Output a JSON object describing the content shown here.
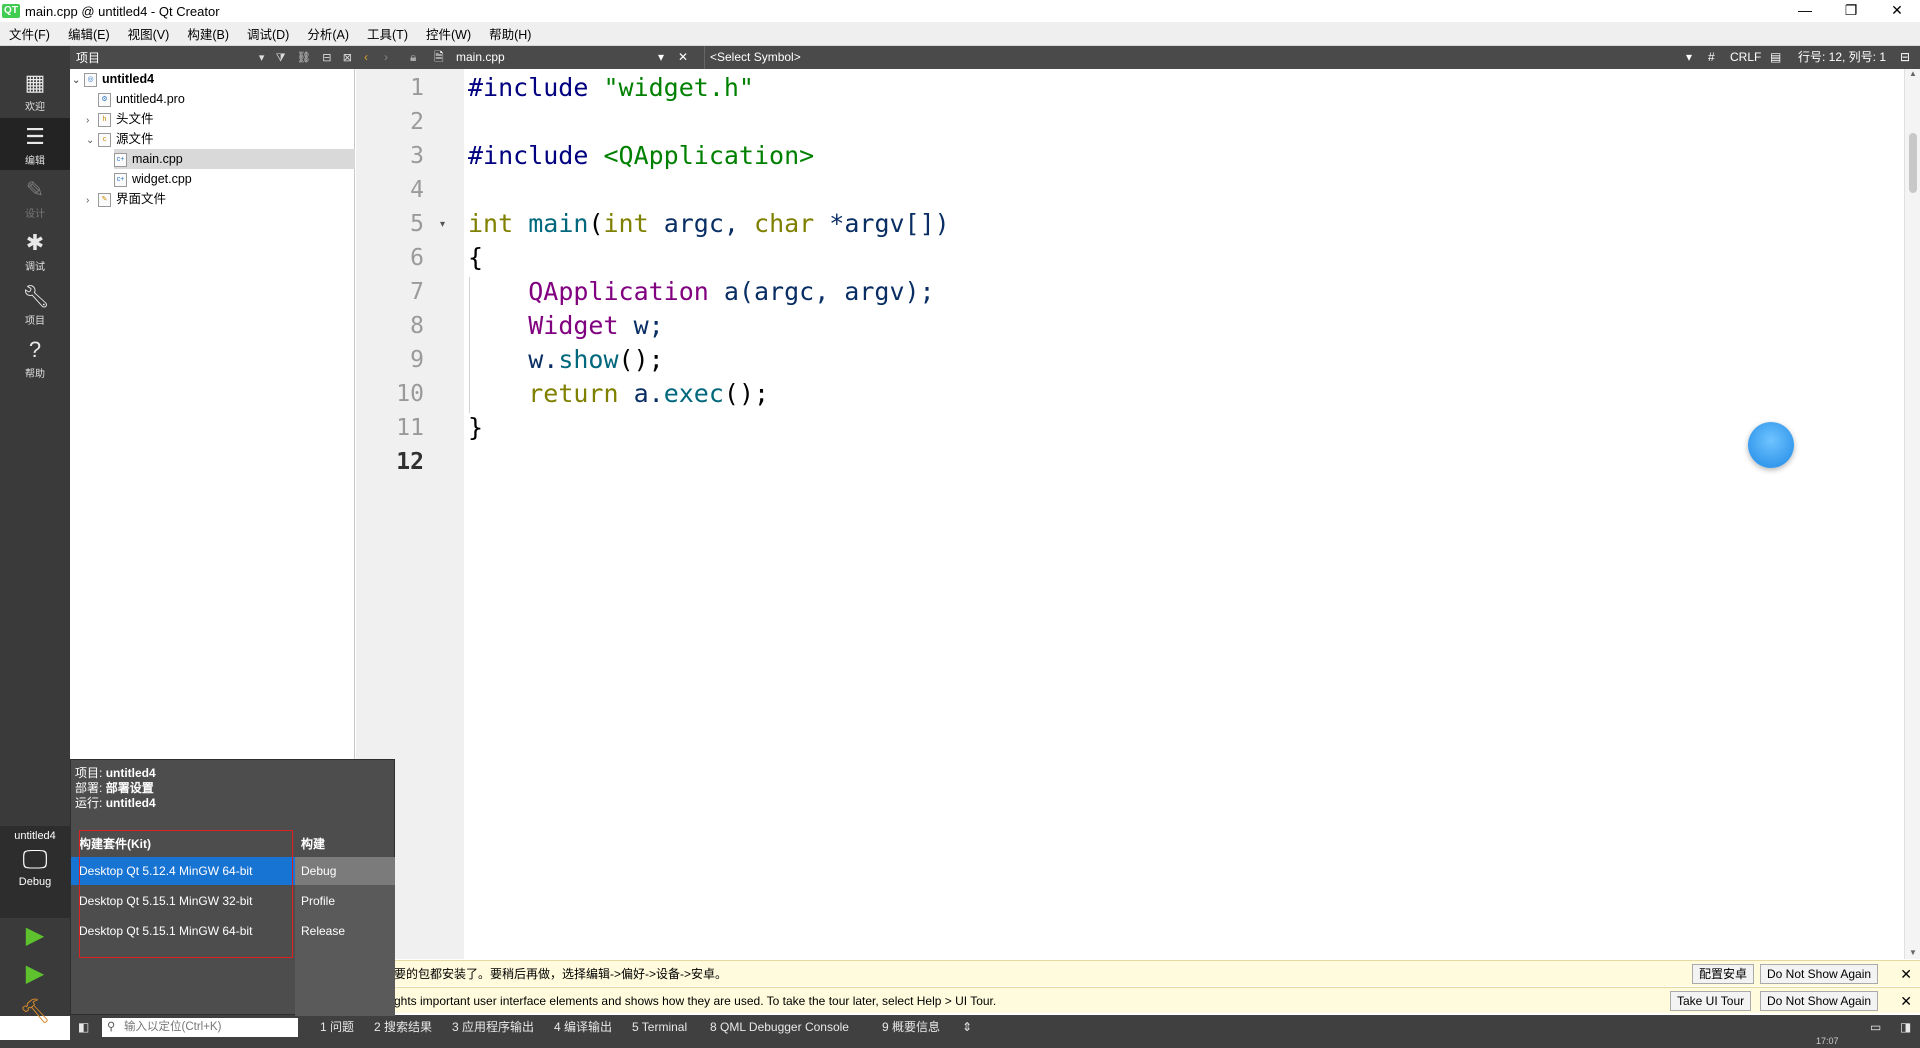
{
  "window": {
    "logo": "QT",
    "title": "main.cpp @ untitled4 - Qt Creator",
    "controls": [
      "—",
      "❐",
      "✕"
    ]
  },
  "menu": [
    "文件(F)",
    "编辑(E)",
    "视图(V)",
    "构建(B)",
    "调试(D)",
    "分析(A)",
    "工具(T)",
    "控件(W)",
    "帮助(H)"
  ],
  "modes": [
    {
      "label": "欢迎",
      "icon": "grid-icon"
    },
    {
      "label": "编辑",
      "icon": "edit-icon"
    },
    {
      "label": "设计",
      "icon": "pencil-icon"
    },
    {
      "label": "调试",
      "icon": "bug-icon"
    },
    {
      "label": "项目",
      "icon": "wrench-icon"
    },
    {
      "label": "帮助",
      "icon": "help-icon"
    }
  ],
  "project_panel": {
    "title": "项目",
    "tree": [
      {
        "label": "untitled4",
        "level": 0,
        "expanded": true,
        "bold": true
      },
      {
        "label": "untitled4.pro",
        "level": 1
      },
      {
        "label": "头文件",
        "level": 1,
        "expanded": false
      },
      {
        "label": "源文件",
        "level": 1,
        "expanded": true
      },
      {
        "label": "main.cpp",
        "level": 2,
        "selected": true
      },
      {
        "label": "widget.cpp",
        "level": 2
      },
      {
        "label": "界面文件",
        "level": 1,
        "expanded": false
      }
    ]
  },
  "editor_toolbar": {
    "file": "main.cpp",
    "symbol": "<Select Symbol>",
    "hash": "#",
    "line_ending": "CRLF",
    "position": "行号: 12, 列号: 1"
  },
  "code_lines": [
    "1",
    "2",
    "3",
    "4",
    "5",
    "6",
    "7",
    "8",
    "9",
    "10",
    "11",
    "12"
  ],
  "code": {
    "l1a": "#include ",
    "l1b": "\"widget.h\"",
    "l3a": "#include ",
    "l3b": "<QApplication>",
    "l5a": "int",
    "l5b": " ",
    "l5c": "main",
    "l5d": "(",
    "l5e": "int",
    "l5f": " argc, ",
    "l5g": "char",
    "l5h": " *argv[])",
    "l6": "{",
    "l7a": "    ",
    "l7b": "QApplication",
    "l7c": " a(argc, argv);",
    "l8a": "    ",
    "l8b": "Widget",
    "l8c": " w;",
    "l9a": "    w.",
    "l9b": "show",
    "l9c": "();",
    "l10a": "    ",
    "l10b": "return",
    "l10c": " a.",
    "l10d": "exec",
    "l10e": "();",
    "l11": "}"
  },
  "infobars": [
    {
      "message": "要的包都安装了。要稍后再做，选择编辑->偏好->设备->安卓。",
      "buttons": [
        "配置安卓",
        "Do Not Show Again"
      ]
    },
    {
      "message": "ghts important user interface elements and shows how they are used. To take the tour later, select Help > UI Tour.",
      "buttons": [
        "Take UI Tour",
        "Do Not Show Again"
      ]
    }
  ],
  "output_panes": {
    "locator_placeholder": "输入以定位(Ctrl+K)",
    "tabs": [
      "1 问题",
      "2 搜索结果",
      "3 应用程序输出",
      "4 编译输出",
      "5 Terminal",
      "8 QML Debugger Console",
      "9 概要信息"
    ]
  },
  "kit_popup": {
    "project_label": "项目:",
    "project_value": "untitled4",
    "deploy_label": "部署:",
    "deploy_value": "部署设置",
    "run_label": "运行:",
    "run_value": "untitled4",
    "kit_header": "构建套件(Kit)",
    "build_header": "构建",
    "kits": [
      "Desktop Qt 5.12.4 MinGW 64-bit",
      "Desktop Qt 5.15.1 MinGW 32-bit",
      "Desktop Qt 5.15.1 MinGW 64-bit"
    ],
    "builds": [
      "Debug",
      "Profile",
      "Release"
    ]
  },
  "target": {
    "project": "untitled4",
    "config": "Debug"
  },
  "status_clock": "17:07"
}
